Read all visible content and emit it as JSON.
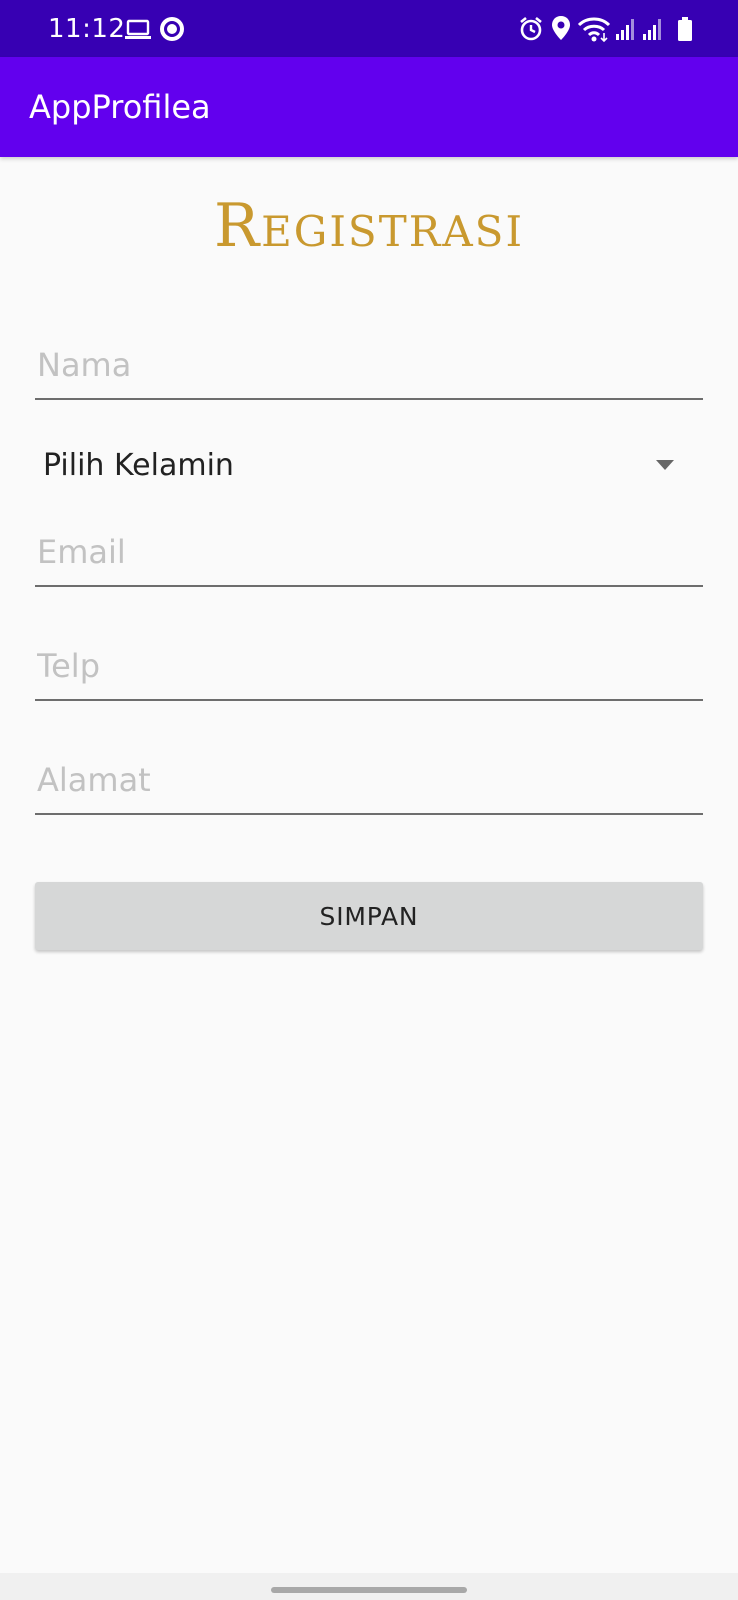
{
  "status_bar": {
    "time": "11:12",
    "left_icons": [
      "laptop-icon",
      "sync-icon"
    ],
    "right_icons": [
      "alarm-icon",
      "location-icon",
      "wifi-icon",
      "signal-icon",
      "signal-icon",
      "battery-icon"
    ],
    "background_color": "#3700b3"
  },
  "app_bar": {
    "title": "AppProfilea",
    "background_color": "#6200ee"
  },
  "form": {
    "heading": "Registrasi",
    "heading_color": "#c9992f",
    "name_placeholder": "Nama",
    "gender_selected": "Pilih Kelamin",
    "email_placeholder": "Email",
    "phone_placeholder": "Telp",
    "address_placeholder": "Alamat",
    "save_label": "SIMPAN"
  }
}
